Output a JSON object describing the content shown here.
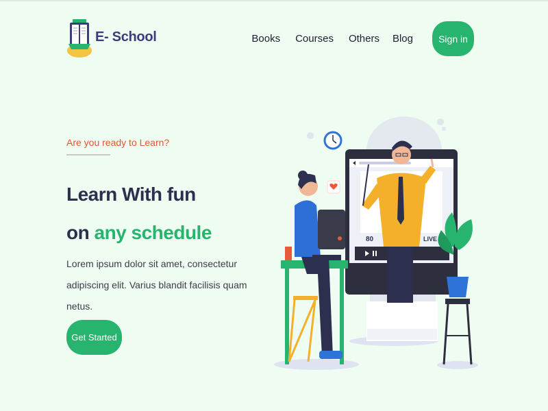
{
  "brand": {
    "name": "E- School"
  },
  "nav": {
    "links": [
      "Books",
      "Courses",
      "Others",
      "Blog"
    ],
    "signin_label": "Sign in"
  },
  "hero": {
    "eyebrow": "Are you ready to Learn?",
    "headline_line1": "Learn With fun",
    "headline_line2_prefix": "on ",
    "headline_line2_accent": "any schedule",
    "description": "Lorem ipsum dolor sit amet, consectetur adipiscing elit. Varius blandit facilisis quam netus.",
    "cta_label": "Get Started"
  },
  "illustration": {
    "viewer_count": "80",
    "live_label": "LIVE"
  },
  "colors": {
    "background": "#effcf2",
    "primary": "#27b46e",
    "accent_orange": "#e8542d",
    "heading": "#2d2f4e",
    "brand_text": "#3b3c7a"
  }
}
